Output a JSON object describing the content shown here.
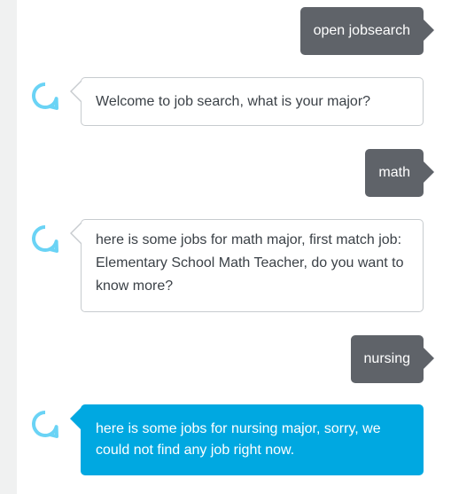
{
  "messages": [
    {
      "role": "user",
      "text": "open jobsearch"
    },
    {
      "role": "alexa",
      "text": "Welcome to job search, what is your major?"
    },
    {
      "role": "user",
      "text": "math"
    },
    {
      "role": "alexa",
      "text": "here is some jobs for math major, first match job: Elementary School Math Teacher, do you want to know more?"
    },
    {
      "role": "user",
      "text": "nursing"
    },
    {
      "role": "alexa",
      "text": "here is some jobs for nursing major, sorry, we could not find any job right now."
    }
  ],
  "icons": {
    "alexa": "alexa-ring-icon"
  },
  "colors": {
    "user_bubble": "#5f6369",
    "alexa_bubble_border": "#c7cbcf",
    "alexa_active_bubble": "#00a8e1",
    "alexa_ring": "#6ad3f5",
    "left_rail": "#f0f1f1"
  }
}
